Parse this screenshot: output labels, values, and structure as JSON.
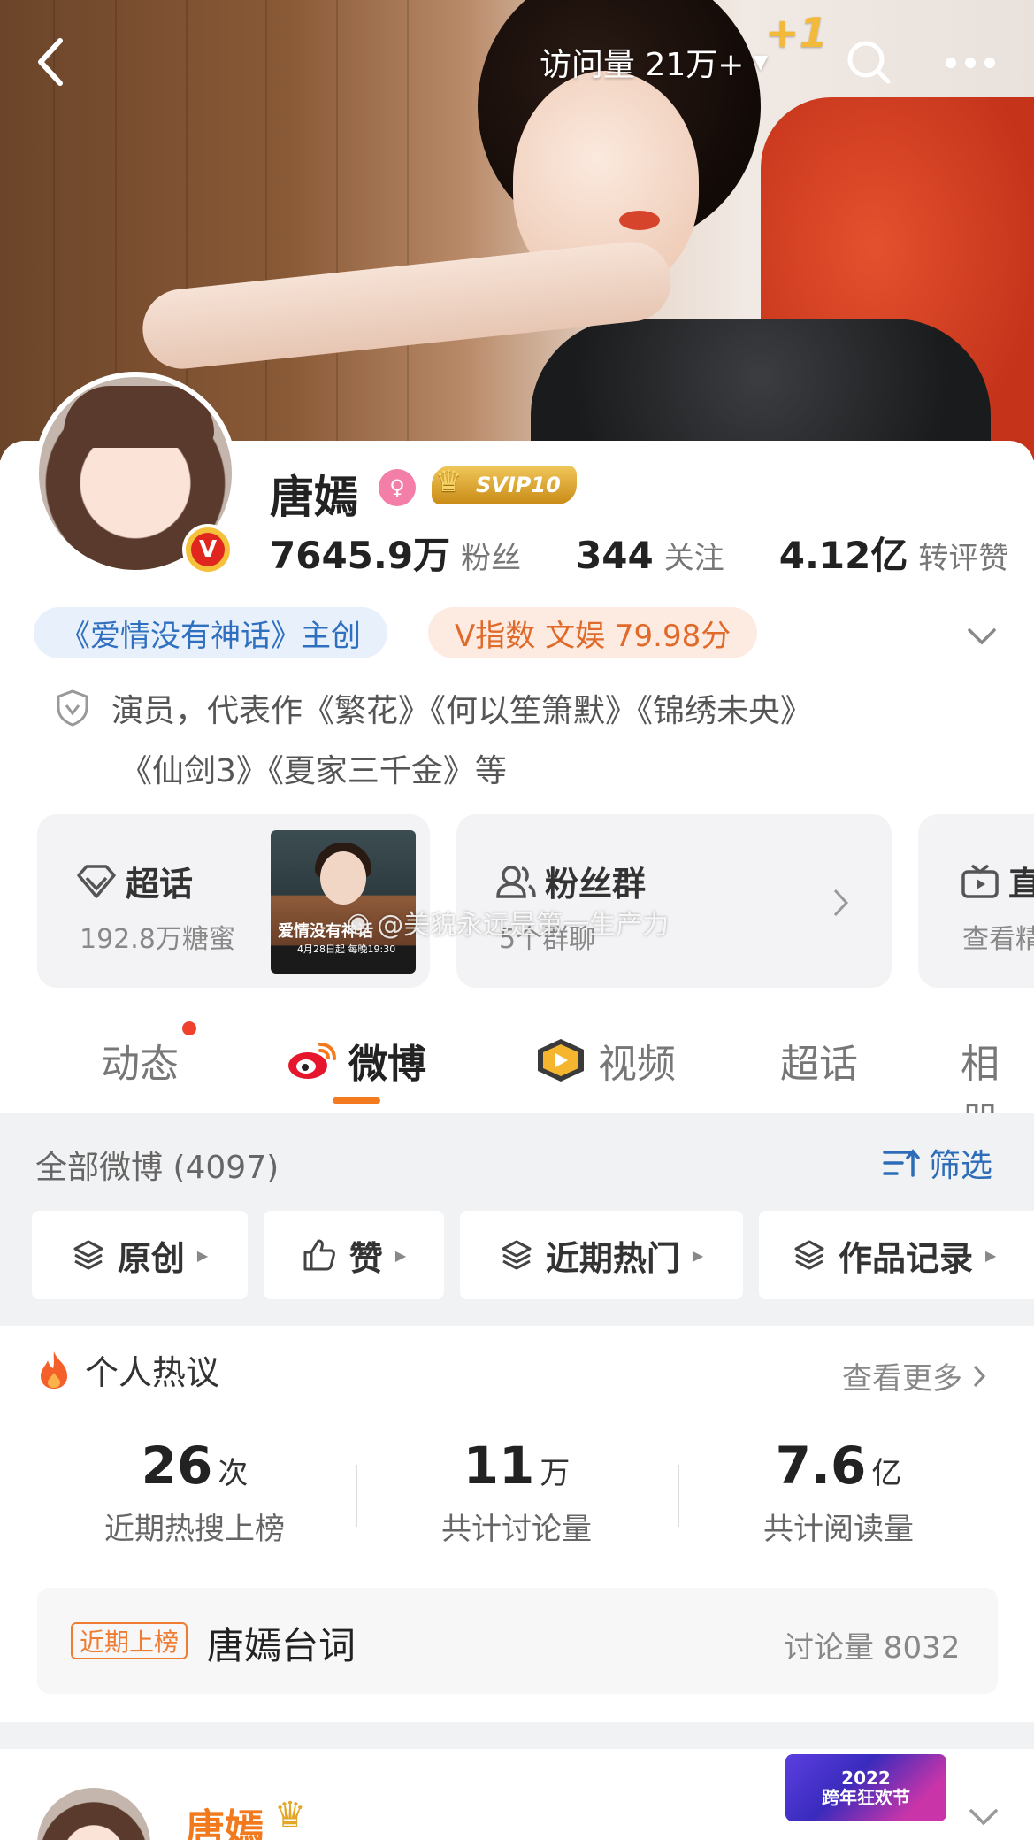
{
  "header": {
    "visits_label": "访问量 21万+",
    "plus_one": "+1",
    "back_icon": "chevron-left-icon",
    "search_icon": "search-icon",
    "more_icon": "more-icon"
  },
  "profile": {
    "name": "唐嫣",
    "vip_badge": "SVIP10",
    "verified": "V",
    "stats": [
      {
        "num": "7645.9万",
        "label": "粉丝"
      },
      {
        "num": "344",
        "label": "关注"
      },
      {
        "num": "4.12亿",
        "label": "转评赞"
      }
    ],
    "tags": {
      "show": "《爱情没有神话》主创",
      "index": "V指数 文娱 79.98分"
    },
    "bio_line1": "演员，代表作《繁花》《何以笙箫默》《锦绣未央》",
    "bio_line2": "《仙剑3》《夏家三千金》等"
  },
  "tiles": [
    {
      "title": "超话",
      "sub": "192.8万糖蜜",
      "poster_title": "爱情没有神话",
      "poster_date": "4月28日起 每晚19:30"
    },
    {
      "title": "粉丝群",
      "sub": "5个群聊"
    },
    {
      "title": "直",
      "sub": "查看精"
    }
  ],
  "watermark": "@美貌永远是第一生产力",
  "tabs": [
    {
      "label": "动态"
    },
    {
      "label": "微博"
    },
    {
      "label": "视频"
    },
    {
      "label": "超话"
    },
    {
      "label": "相册"
    }
  ],
  "filter": {
    "all_posts": "全部微博 (4097)",
    "filter_label": "筛选",
    "chips": [
      "原创",
      "赞",
      "近期热门",
      "作品记录"
    ]
  },
  "hot": {
    "title": "个人热议",
    "see_more": "查看更多",
    "metrics": [
      {
        "num": "26",
        "unit": "次",
        "label": "近期热搜上榜"
      },
      {
        "num": "11",
        "unit": "万",
        "label": "共计讨论量"
      },
      {
        "num": "7.6",
        "unit": "亿",
        "label": "共计阅读量"
      }
    ],
    "rank_badge": "近期上榜",
    "rank_name": "唐嫣台词",
    "rank_count": "讨论量 8032"
  },
  "post": {
    "author": "唐嫣",
    "event_line1": "2022",
    "event_line2": "跨年狂欢节"
  },
  "colors": {
    "accent_orange": "#f47a20",
    "link_blue": "#2d6cb8",
    "tag_blue": "#2f6fc0",
    "tag_orange": "#e06a2a"
  }
}
